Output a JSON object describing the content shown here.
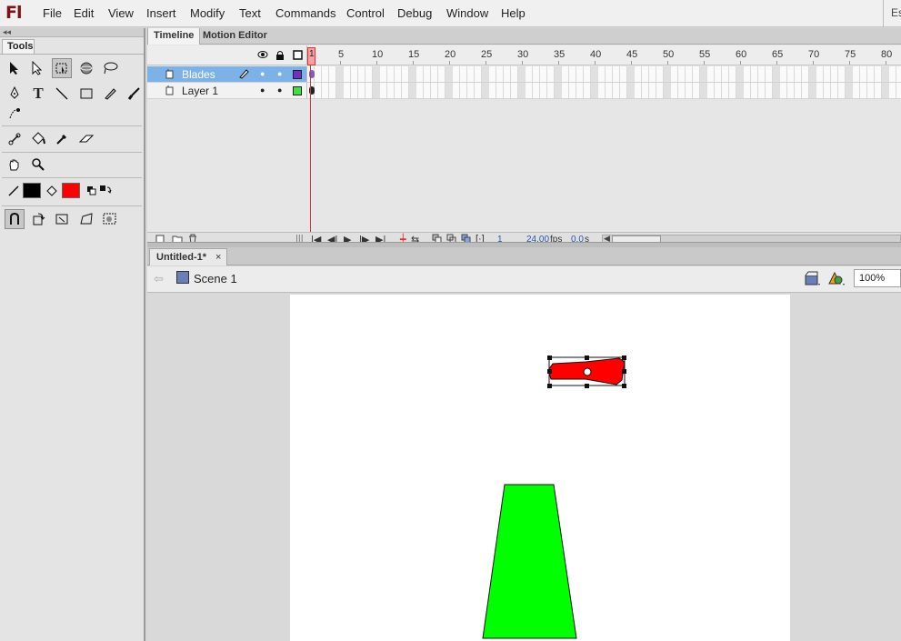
{
  "app": {
    "logo": "Fl",
    "menu": [
      "File",
      "Edit",
      "View",
      "Insert",
      "Modify",
      "Text",
      "Commands",
      "Control",
      "Debug",
      "Window",
      "Help"
    ],
    "menu_right": "Es"
  },
  "tools_panel": {
    "collapse_glyph": "◂◂",
    "title": "Tools",
    "stroke_color": "#000000",
    "fill_color": "#ff0000"
  },
  "timeline": {
    "tabs": [
      "Timeline",
      "Motion Editor"
    ],
    "frame_numbers": [
      "1",
      "5",
      "10",
      "15",
      "20",
      "25",
      "30",
      "35",
      "40",
      "45",
      "50",
      "55",
      "60",
      "65",
      "70",
      "75",
      "80"
    ],
    "layers": [
      {
        "name": "Blades",
        "selected": true,
        "color": "#7030c0"
      },
      {
        "name": "Layer 1",
        "selected": false,
        "color": "#40e040"
      }
    ],
    "footer": {
      "current_frame": "1",
      "fps_value": "24.00",
      "fps_unit": "fps",
      "time_value": "0.0",
      "time_unit": "s"
    }
  },
  "document": {
    "tab_title": "Untitled-1*",
    "tab_close": "×",
    "scene_label": "Scene 1",
    "zoom": "100%",
    "stage_color": "#ffffff",
    "objects": {
      "blade_fill": "#ff0000",
      "trunk_fill": "#00ff00"
    }
  }
}
